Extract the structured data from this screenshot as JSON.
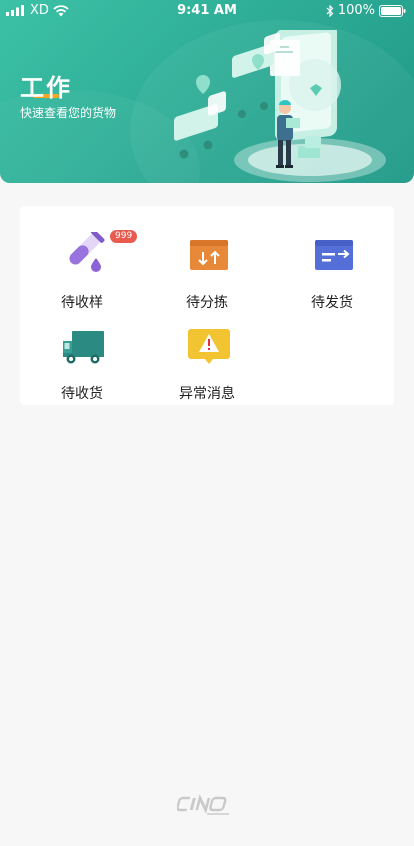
{
  "status_bar": {
    "carrier": "XD",
    "time": "9:41 AM",
    "battery": "100%"
  },
  "header": {
    "title": "工作",
    "subtitle": "快速查看您的货物"
  },
  "colors": {
    "accent": "#2fae97",
    "badge": "#e95b4f",
    "orange": "#e8893a",
    "blue": "#5470d8",
    "purple": "#8b63d6",
    "teal": "#2b8a82",
    "yellow": "#f3c431"
  },
  "tasks": [
    {
      "label": "待收样",
      "icon": "test-tube-icon",
      "badge": "999"
    },
    {
      "label": "待分拣",
      "icon": "sort-box-icon"
    },
    {
      "label": "待发货",
      "icon": "ship-box-icon"
    },
    {
      "label": "待收货",
      "icon": "truck-icon"
    },
    {
      "label": "异常消息",
      "icon": "warning-message-icon"
    }
  ],
  "footer": {
    "logo_text": "CINO"
  }
}
